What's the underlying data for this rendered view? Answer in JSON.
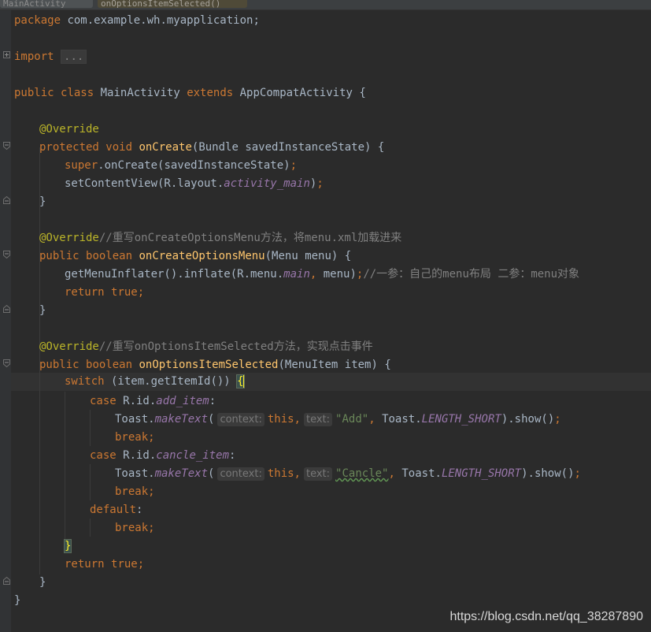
{
  "tabs": [
    {
      "label": "MainActivity",
      "active": false
    },
    {
      "label": "onOptionsItemSelected()",
      "active": true
    }
  ],
  "code": {
    "l1": {
      "k": "package",
      "rest": " com.example.wh.myapplication;"
    },
    "l2": {
      "k": "import",
      "folded": "..."
    },
    "l3": {
      "k1": "public",
      "k2": "class",
      "name": " MainActivity ",
      "k3": "extends",
      "rest": " AppCompatActivity {"
    },
    "l4": {
      "an": "@Override"
    },
    "l5": {
      "k1": "protected",
      "k2": "void",
      "fn": "onCreate",
      "rest": "(Bundle savedInstanceState) {"
    },
    "l6": {
      "k": "super",
      "rest": ".onCreate(savedInstanceState)",
      "semi": ";"
    },
    "l7": {
      "pre": "setContentView(R.layout.",
      "fi": "activity_main",
      "post": ")",
      "semi": ";"
    },
    "l8": {
      "text": "}"
    },
    "l9": {
      "an": "@Override",
      "cm": "//重写onCreateOptionsMenu方法，将menu.xml加载进来"
    },
    "l10": {
      "k1": "public",
      "k2": "boolean",
      "fn": "onCreateOptionsMenu",
      "rest": "(Menu menu) {"
    },
    "l11": {
      "pre": "getMenuInflater().inflate(R.menu.",
      "fi": "main",
      "comma": ",",
      "mid": " menu)",
      "semi": ";",
      "cm": "//一参：自己的menu布局 二参：menu对象"
    },
    "l12": {
      "k": "return",
      "k2": "true",
      "semi": ";"
    },
    "l13": {
      "text": "}"
    },
    "l14": {
      "an": "@Override",
      "cm": "//重写onOptionsItemSelected方法，实现点击事件"
    },
    "l15": {
      "k1": "public",
      "k2": "boolean",
      "fn": "onOptionsItemSelected",
      "rest": "(MenuItem item) {"
    },
    "l16": {
      "k": "switch",
      "rest": " (item.getItemId()) ",
      "brace": "{"
    },
    "l17": {
      "k": "case",
      "pre": " R.id.",
      "fi": "add_item",
      "post": ":"
    },
    "l18": {
      "pre": "Toast.",
      "mt": "makeText",
      "paren": "(",
      "hint1": "context:",
      "this": "this,",
      "hint2": "text:",
      "str": "\"Add\"",
      "comma": ",",
      "mid": " Toast.",
      "fi": "LENGTH_SHORT",
      "post": ").show()",
      "semi": ";"
    },
    "l19": {
      "k": "break",
      "semi": ";"
    },
    "l20": {
      "k": "case",
      "pre": " R.id.",
      "fi": "cancle_item",
      "post": ":"
    },
    "l21": {
      "pre": "Toast.",
      "mt": "makeText",
      "paren": "(",
      "hint1": "context:",
      "this": "this,",
      "hint2": "text:",
      "str": "\"Cancle\"",
      "comma": ",",
      "mid": " Toast.",
      "fi": "LENGTH_SHORT",
      "post": ").show()",
      "semi": ";"
    },
    "l22": {
      "k": "break",
      "semi": ";"
    },
    "l23": {
      "k": "default",
      "post": ":"
    },
    "l24": {
      "k": "break",
      "semi": ";"
    },
    "l25": {
      "brace": "}"
    },
    "l26": {
      "k": "return",
      "k2": "true",
      "semi": ";"
    },
    "l27": {
      "text": "}"
    },
    "l28": {
      "text": "}"
    }
  },
  "watermark": "https://blog.csdn.net/qq_38287890",
  "colors": {
    "background": "#2b2b2b",
    "keyword": "#cc7832",
    "annotation": "#bbb529",
    "method": "#ffc66d",
    "string": "#6a8759",
    "field": "#9876aa",
    "comment": "#808080",
    "text": "#a9b7c6"
  }
}
